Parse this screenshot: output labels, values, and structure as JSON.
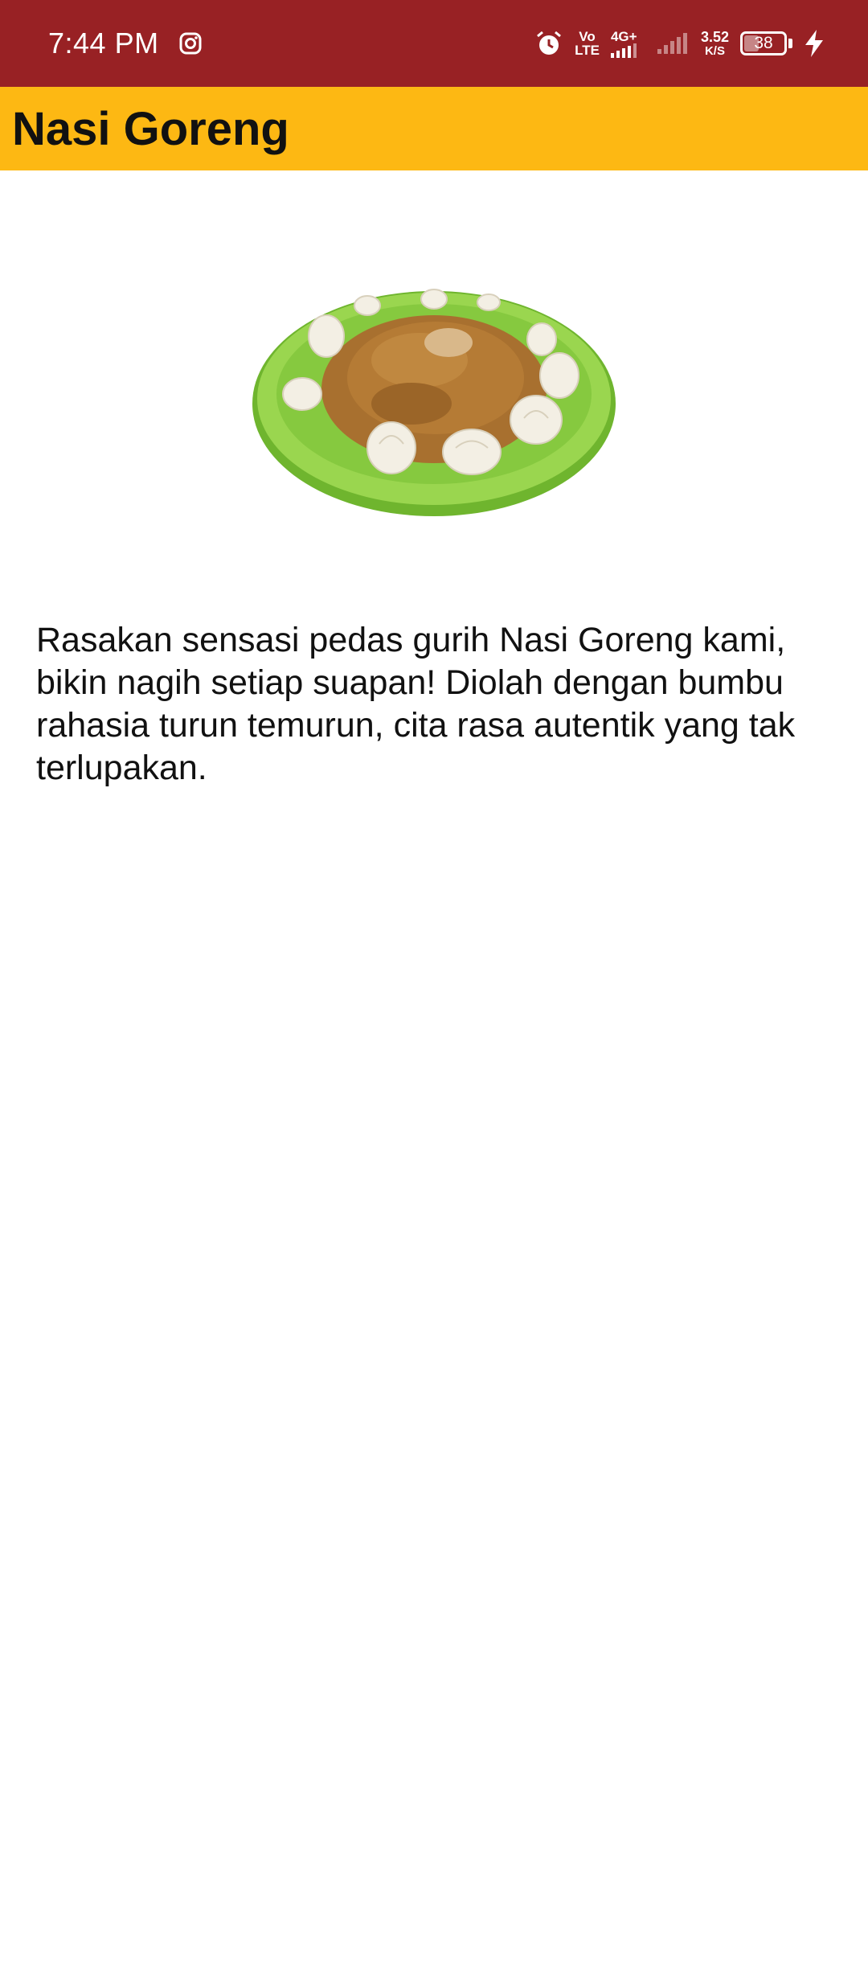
{
  "status_bar": {
    "time": "7:44 PM",
    "volte_top": "Vo",
    "volte_bottom": "LTE",
    "network": "4G+",
    "speed_value": "3.52",
    "speed_unit": "K/S",
    "battery_level": "38",
    "battery_fraction": 0.38,
    "icons": [
      "instagram-icon",
      "alarm-icon",
      "signal-icon",
      "charging-icon"
    ]
  },
  "app_bar": {
    "title": "Nasi Goreng",
    "color": "#FDB813"
  },
  "content": {
    "image_subject": "nasi-goreng-dish-image",
    "description": "Rasakan sensasi pedas gurih Nasi Goreng kami, bikin nagih setiap suapan! Diolah dengan bumbu rahasia turun temurun, cita rasa autentik yang tak terlupakan."
  },
  "colors": {
    "status_bar": "#982124",
    "plate": "#8fd14a",
    "noodles": "#a8702f"
  }
}
